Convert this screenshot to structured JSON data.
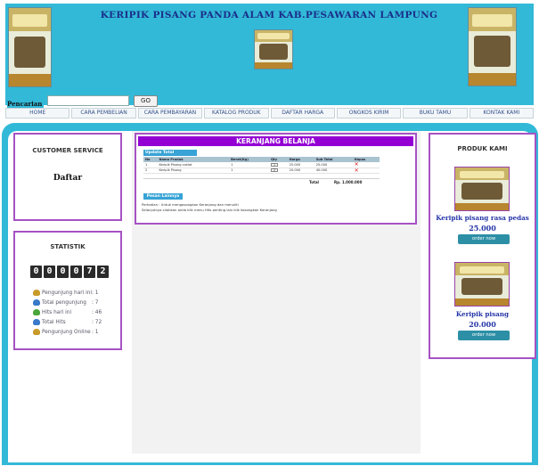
{
  "header": {
    "title": "KERIPIK PISANG PANDA ALAM KAB.PESAWARAN LAMPUNG",
    "brand_color": "#32b9d8"
  },
  "search": {
    "label": "Pencarian",
    "value": "",
    "button": "GO"
  },
  "nav": [
    "HOME",
    "CARA PEMBELIAN",
    "CARA PEMBAYARAN",
    "KATALOG PRODUK",
    "DAFTAR HARGA",
    "ONGKOS KIRIM",
    "BUKU TAMU",
    "KONTAK KAMI"
  ],
  "customer_service": {
    "title": "CUSTOMER SERVICE",
    "link": "Daftar"
  },
  "statistik": {
    "title": "STATISTIK",
    "counter": [
      "0",
      "0",
      "0",
      "0",
      "7",
      "2"
    ],
    "rows": [
      {
        "label": "Pengunjung hari ini",
        "value": ": 1",
        "icon": "users-icon"
      },
      {
        "label": "Total pengunjung",
        "value": ": 7",
        "icon": "users-icon"
      },
      {
        "label": "Hits hari ini",
        "value": ": 46",
        "icon": "users-icon"
      },
      {
        "label": "Total Hits",
        "value": ": 72",
        "icon": "users-icon"
      },
      {
        "label": "Pengunjung Online",
        "value": ": 1",
        "icon": "users-icon"
      }
    ]
  },
  "cart": {
    "title": "KERANJANG BELANJA",
    "tab": "Update Total Pembayaran",
    "columns": [
      "No",
      "Nama Produk",
      "Berat(Kg)",
      "Qty",
      "Harga",
      "Sub Total",
      "Hapus"
    ],
    "rows": [
      {
        "no": "1",
        "name": "Keripik Pisang coklat",
        "weight": "1",
        "qty": "1",
        "price": "25.000",
        "subtotal": "25.000"
      },
      {
        "no": "2",
        "name": "Keripik Pisang",
        "weight": "1",
        "qty": "2",
        "price": "20.000",
        "subtotal": "40.000"
      }
    ],
    "total_label": "Total",
    "total_value": "Rp. 1.000.000",
    "order_button": "Pesan Lainnya",
    "note1": "Perhatian : Untuk mengosongkan Keranjang dan menuliti",
    "note2": "Selanjutnya silahkan anda klik menu Hits penting lalu klik kosongkan Keranjang"
  },
  "produk": {
    "title": "PRODUK KAMI",
    "items": [
      {
        "name": "Keripik pisang rasa pedas",
        "price": "25.000",
        "button": "order now"
      },
      {
        "name": "Keripik pisang",
        "price": "20.000",
        "button": "order now"
      }
    ]
  }
}
